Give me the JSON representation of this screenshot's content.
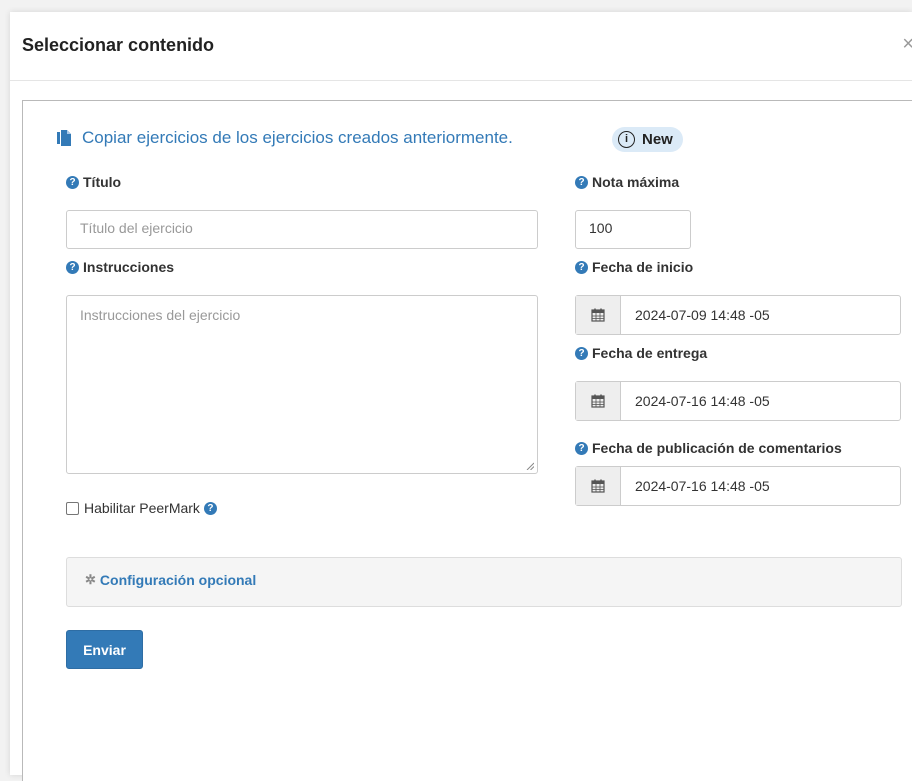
{
  "modal": {
    "title": "Seleccionar contenido",
    "close_glyph": "×"
  },
  "copy": {
    "link_text": "Copiar ejercicios de los ejercicios creados anteriormente.",
    "icon": "copy-document-icon",
    "badge_info_glyph": "i",
    "badge_text": "New"
  },
  "form": {
    "help_glyph": "?",
    "title": {
      "label": "Título",
      "placeholder": "Título del ejercicio",
      "value": ""
    },
    "instructions": {
      "label": "Instrucciones",
      "placeholder": "Instrucciones del ejercicio",
      "value": ""
    },
    "max_grade": {
      "label": "Nota máxima",
      "value": "100"
    },
    "start_date": {
      "label": "Fecha de inicio",
      "value": "2024-07-09 14:48 -05"
    },
    "due_date": {
      "label": "Fecha de entrega",
      "value": "2024-07-16 14:48 -05"
    },
    "feedback_date": {
      "label": "Fecha de publicación de comentarios",
      "value": "2024-07-16 14:48 -05"
    },
    "peermark": {
      "label": "Habilitar PeerMark",
      "checked": false
    },
    "optional": {
      "gear_glyph": "✲",
      "label": "Configuración opcional"
    },
    "submit_label": "Enviar"
  },
  "colors": {
    "accent": "#337ab7",
    "badge_bg": "#dbeaf7",
    "panel_bg": "#f5f5f5"
  }
}
